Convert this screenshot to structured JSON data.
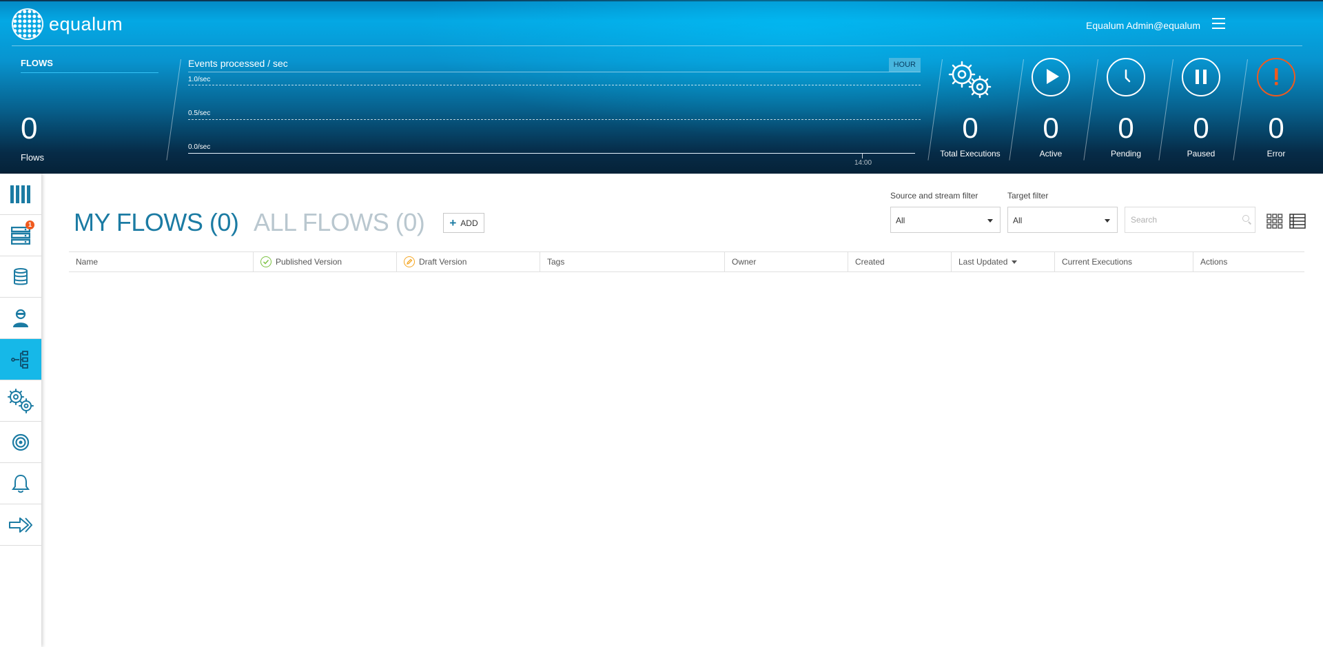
{
  "app": {
    "brand": "equalum",
    "user": "Equalum Admin@equalum"
  },
  "flows_panel": {
    "title": "FLOWS",
    "count": "0",
    "label": "Flows"
  },
  "chart_data": {
    "type": "line",
    "title": "Events processed / sec",
    "ylabel": "",
    "xlabel": "",
    "yticks": [
      "1.0/sec",
      "0.5/sec",
      "0.0/sec"
    ],
    "ylim": [
      0,
      1.0
    ],
    "xticks": [
      "14:00"
    ],
    "series": [],
    "grid": true,
    "range_button": "HOUR"
  },
  "stats": [
    {
      "label": "Total Executions",
      "value": "0",
      "icon": "gears-icon"
    },
    {
      "label": "Active",
      "value": "0",
      "icon": "play-icon"
    },
    {
      "label": "Pending",
      "value": "0",
      "icon": "clock-icon"
    },
    {
      "label": "Paused",
      "value": "0",
      "icon": "pause-icon"
    },
    {
      "label": "Error",
      "value": "0",
      "icon": "error-icon",
      "color": "#f05a1e"
    }
  ],
  "sidebar": {
    "items": [
      {
        "name": "dashboard",
        "icon": "columns-icon"
      },
      {
        "name": "agents",
        "icon": "servers-icon",
        "badge": "1"
      },
      {
        "name": "sources",
        "icon": "database-icon"
      },
      {
        "name": "users",
        "icon": "user-icon"
      },
      {
        "name": "flows",
        "icon": "flow-icon",
        "active": true
      },
      {
        "name": "settings",
        "icon": "gears-icon"
      },
      {
        "name": "targets",
        "icon": "target-icon"
      },
      {
        "name": "notifications",
        "icon": "bell-icon"
      },
      {
        "name": "export",
        "icon": "arrow-icon"
      }
    ]
  },
  "main": {
    "tabs": {
      "my_flows": "MY FLOWS (0)",
      "all_flows": "ALL FLOWS (0)"
    },
    "add_label": "ADD",
    "filters": {
      "source_label": "Source and stream filter",
      "source_value": "All",
      "target_label": "Target filter",
      "target_value": "All"
    },
    "search": {
      "placeholder": "Search"
    },
    "table": {
      "columns": [
        "Name",
        "Published Version",
        "Draft Version",
        "Tags",
        "Owner",
        "Created",
        "Last Updated",
        "Current Executions",
        "Actions"
      ],
      "rows": []
    }
  },
  "colors": {
    "accent": "#1b7ba3",
    "active_sidebar": "#16b8e8",
    "published": "#7cc242",
    "draft": "#f5a623",
    "error": "#f05a1e"
  }
}
